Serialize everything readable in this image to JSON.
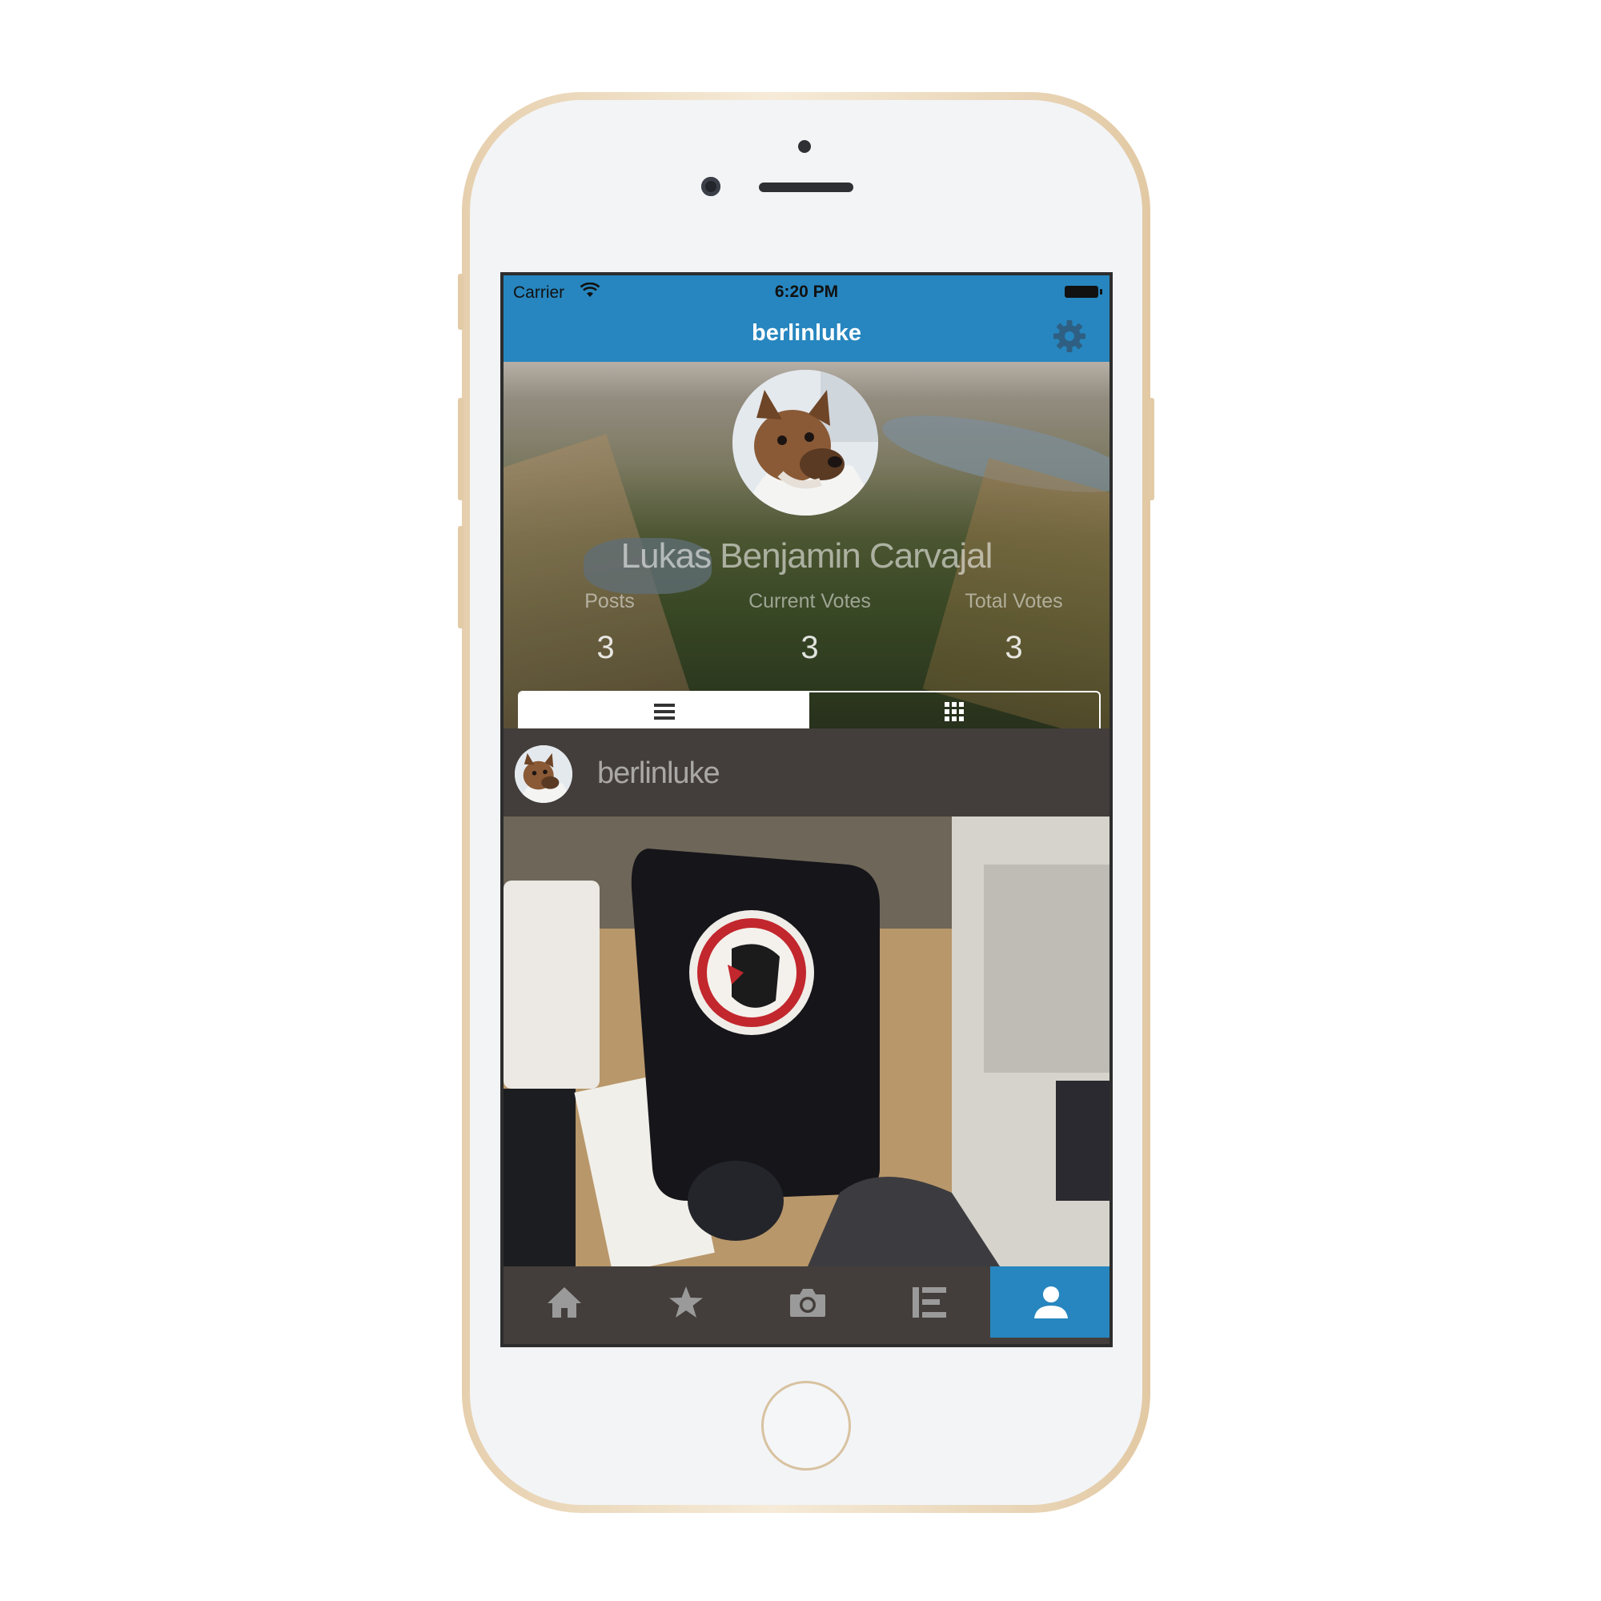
{
  "status_bar": {
    "carrier": "Carrier",
    "time": "6:20 PM"
  },
  "nav": {
    "title": "berlinluke",
    "settings_icon": "gear-icon"
  },
  "profile": {
    "name": "Lukas Benjamin Carvajal",
    "stats": [
      {
        "label": "Posts",
        "value": "3"
      },
      {
        "label": "Current Votes",
        "value": "3"
      },
      {
        "label": "Total Votes",
        "value": "3"
      }
    ],
    "view_toggle": {
      "selected": "list",
      "options": [
        "list-icon",
        "grid-icon"
      ]
    }
  },
  "post": {
    "username": "berlinluke"
  },
  "tab_bar": {
    "items": [
      {
        "icon": "home-icon",
        "active": false
      },
      {
        "icon": "star-icon",
        "active": false
      },
      {
        "icon": "camera-icon",
        "active": false
      },
      {
        "icon": "leaderboard-icon",
        "active": false
      },
      {
        "icon": "profile-icon",
        "active": true
      }
    ]
  },
  "colors": {
    "accent": "#2786bf",
    "dark_bar": "#433e3b"
  }
}
